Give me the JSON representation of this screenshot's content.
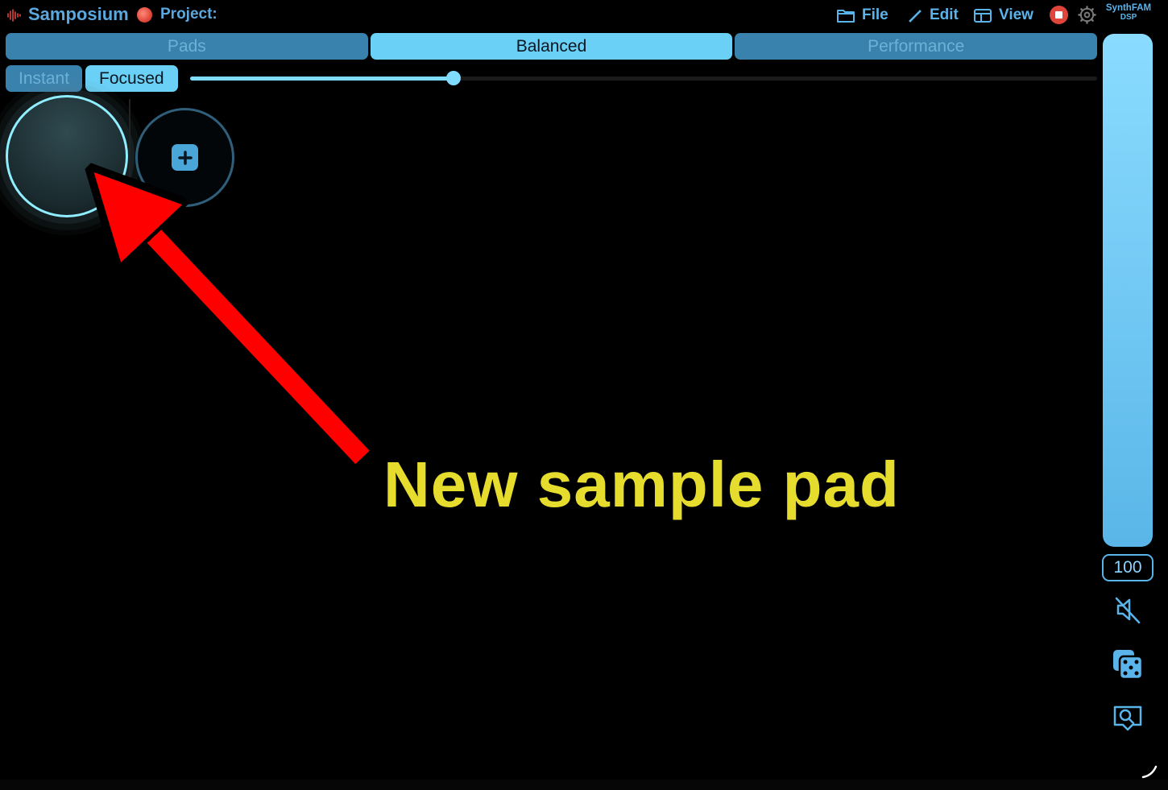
{
  "header": {
    "app_name": "Samposium",
    "project_label": "Project:",
    "menu": [
      {
        "label": "File",
        "icon": "folder-icon"
      },
      {
        "label": "Edit",
        "icon": "pencil-icon"
      },
      {
        "label": "View",
        "icon": "layout-icon"
      }
    ],
    "brand_line1": "SynthFAM",
    "brand_line2": "DSP"
  },
  "mode_tabs": [
    {
      "label": "Pads",
      "active": false
    },
    {
      "label": "Balanced",
      "active": true
    },
    {
      "label": "Performance",
      "active": false
    }
  ],
  "sub_tabs": [
    {
      "label": "Instant",
      "active": false
    },
    {
      "label": "Focused",
      "active": true
    }
  ],
  "slider": {
    "value": 0.29
  },
  "volume": {
    "value": "100",
    "level": 1.0
  },
  "annotation": {
    "text": "New sample pad"
  },
  "colors": {
    "accent": "#6ad0f6",
    "tab_inactive": "#3a82ae",
    "annotation_arrow": "#ff0000",
    "annotation_text": "#e6dc2e",
    "record": "#e0453c"
  }
}
